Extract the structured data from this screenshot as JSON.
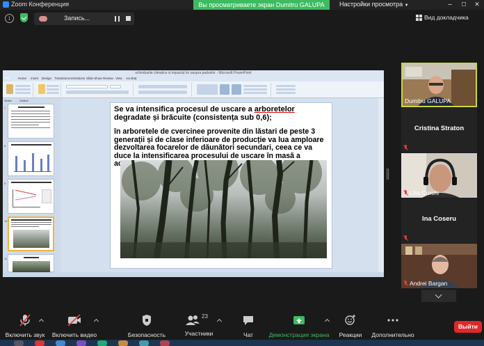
{
  "titlebar": {
    "app_name": "Zoom Конференция",
    "share_banner": "Вы просматриваете экран Dumitru GALUPA",
    "view_settings": "Настройки просмотра",
    "minimize": "–",
    "maximize": "☐",
    "close": "✕"
  },
  "topbar": {
    "info_glyph": "i",
    "recording_label": "Запись...",
    "doc_view_label": "Вид докладчика"
  },
  "presentation": {
    "window_title": "schimbarile climatice si impactul lor asupra padurilor - Microsoft PowerPoint",
    "ribbon_tabs": [
      "File",
      "Home",
      "Insert",
      "Design",
      "Transitions",
      "Animations",
      "Slide Show",
      "Review",
      "View",
      "Acrobat"
    ],
    "pane_tabs": [
      "Slides",
      "Outline"
    ],
    "thumbnail_numbers": [
      "7",
      "8",
      "9",
      "10",
      "11"
    ],
    "slide_heading_pre": "Se va intensifica procesul de uscare a ",
    "slide_heading_link": "arboretelor",
    "slide_heading_post": " degradate și brăcuite (consistența sub 0,6);",
    "slide_body": "în arboretele de cvercinee provenite din lăstari de peste 3 generații și de clase inferioare de producție  va lua amploare dezvoltarea focarelor de dăunători secundari, ceea ce va duce la intensificarea procesului de uscare în masă a acestora ."
  },
  "participants": [
    {
      "name": "Dumitru GALUPA",
      "video": true,
      "active": true,
      "muted": false
    },
    {
      "name": "Cristina Straton",
      "video": false,
      "active": false,
      "muted": true
    },
    {
      "name": "Lilia Curchi",
      "video": true,
      "active": false,
      "muted": true
    },
    {
      "name": "Ina Coseru",
      "video": false,
      "active": false,
      "muted": true
    },
    {
      "name": "Andrei Bargan",
      "video": true,
      "active": false,
      "muted": true
    }
  ],
  "toolbar": {
    "audio_label": "Включить звук",
    "video_label": "Включить видео",
    "security_label": "Безопасность",
    "participants_label": "Участники",
    "participants_count": "23",
    "chat_label": "Чат",
    "share_label": "Демонстрация экрана",
    "reactions_label": "Реакции",
    "more_label": "Дополнительно",
    "leave_label": "Выйти"
  },
  "colors": {
    "share_green": "#3dbb61",
    "active_speaker_border": "#c7d93a",
    "leave_red": "#e02828",
    "muted_red": "#e23d3d"
  }
}
